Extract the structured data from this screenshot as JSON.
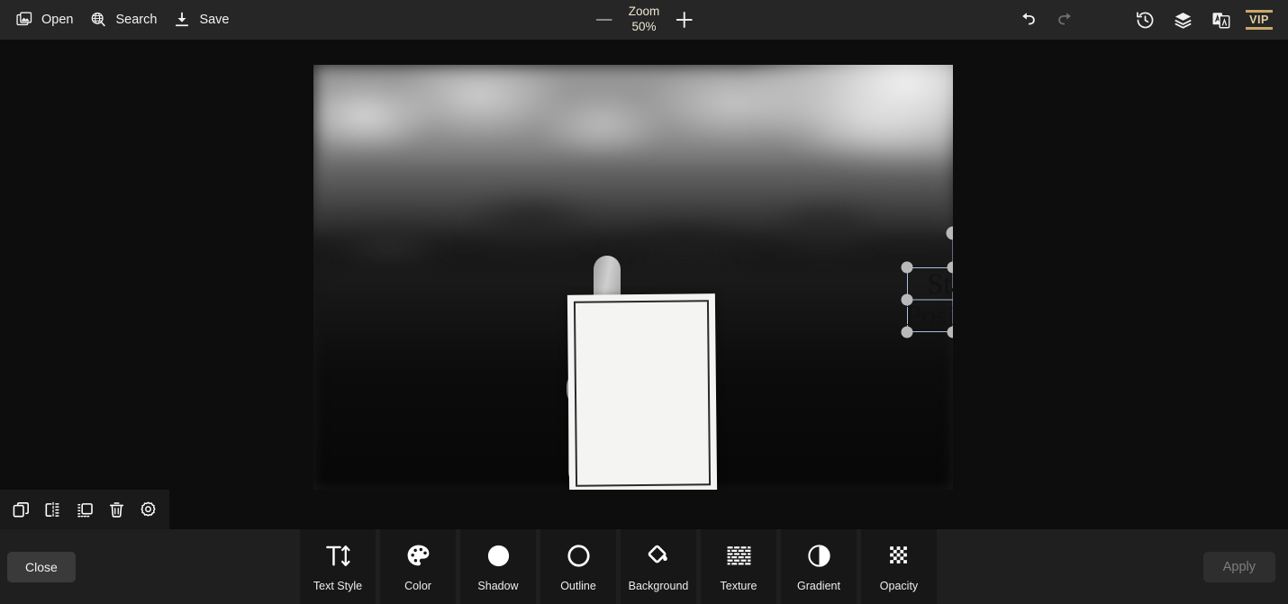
{
  "header": {
    "open": {
      "label": "Open",
      "icon": "images-icon"
    },
    "search": {
      "label": "Search",
      "icon": "globe-search-icon"
    },
    "save": {
      "label": "Save",
      "icon": "download-icon"
    },
    "zoom": {
      "title": "Zoom",
      "value": "50%",
      "minus_icon": "minus-icon",
      "plus_icon": "plus-icon"
    },
    "actions": {
      "undo": "undo-icon",
      "redo": "redo-icon",
      "history": "history-clock-icon",
      "layers": "layers-icon",
      "translate": "translate-icon",
      "vip": "VIP"
    }
  },
  "canvas": {
    "selected_text": {
      "line1": "Stay",
      "line2": "Positive"
    },
    "rotation_handle": "rotate-handle",
    "handles": [
      "handle-top-left",
      "handle-top-center",
      "handle-top-right",
      "handle-middle-left",
      "handle-middle-right",
      "handle-bottom-left",
      "handle-bottom-center",
      "handle-bottom-right"
    ]
  },
  "object_toolbar": {
    "items": [
      {
        "name": "duplicate",
        "icon": "duplicate-icon"
      },
      {
        "name": "flip-horizontal",
        "icon": "flip-horizontal-icon"
      },
      {
        "name": "arrange",
        "icon": "arrange-icon"
      },
      {
        "name": "delete",
        "icon": "trash-icon"
      },
      {
        "name": "settings",
        "icon": "gear-icon"
      }
    ]
  },
  "bottom": {
    "close_label": "Close",
    "apply_label": "Apply",
    "tools": [
      {
        "label": "Text Style",
        "icon": "text-size-icon"
      },
      {
        "label": "Color",
        "icon": "palette-icon"
      },
      {
        "label": "Shadow",
        "icon": "shadow-circle-icon"
      },
      {
        "label": "Outline",
        "icon": "outline-circle-icon"
      },
      {
        "label": "Background",
        "icon": "paint-bucket-icon"
      },
      {
        "label": "Texture",
        "icon": "texture-grid-icon"
      },
      {
        "label": "Gradient",
        "icon": "gradient-circle-icon"
      },
      {
        "label": "Opacity",
        "icon": "checkerboard-icon"
      }
    ]
  },
  "colors": {
    "header_bg": "#262626",
    "stage_bg": "#0d0d0d",
    "bottom_bg": "#1f1f1f",
    "tool_bg": "#171717",
    "accent_gold": "#e4cfa2",
    "selection_blue": "#a8bde0",
    "handle_gray": "#b9b9b9"
  }
}
